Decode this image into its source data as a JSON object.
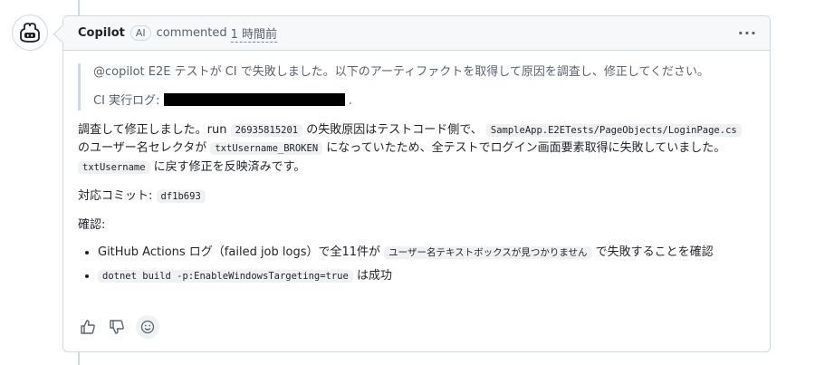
{
  "comment": {
    "author": "Copilot",
    "ai_badge": "AI",
    "action": "commented",
    "timestamp": "1 時間前",
    "quote_line1": "@copilot E2E テストが CI で失敗しました。以下のアーティファクトを取得して原因を調査し、修正してください。",
    "quote_line2_prefix": "CI 実行ログ:",
    "quote_line2_suffix": ".",
    "para1_a": "調査して修正しました。run ",
    "para1_code1": "26935815201",
    "para1_b": " の失敗原因はテストコード側で、",
    "para1_code2": "SampleApp.E2ETests/PageObjects/LoginPage.cs",
    "para1_c": " のユーザー名セレクタが ",
    "para1_code3": "txtUsername_BROKEN",
    "para1_d": " になっていたため、全テストでログイン画面要素取得に失敗していました。",
    "para1_code4": "txtUsername",
    "para1_e": " に戻す修正を反映済みです。",
    "commit_label": "対応コミット: ",
    "commit_hash": "df1b693",
    "confirm_label": "確認:",
    "bullet1_a": "GitHub Actions ログ（failed job logs）で全11件が ",
    "bullet1_code": "ユーザー名テキストボックスが見つかりません",
    "bullet1_b": " で失敗することを確認",
    "bullet2_code": "dotnet build -p:EnableWindowsTargeting=true",
    "bullet2_b": " は成功"
  },
  "icons": {
    "avatar": "copilot-icon",
    "menu": "kebab-icon",
    "thumbs_up": "thumbs-up-icon",
    "thumbs_down": "thumbs-down-icon",
    "emoji": "smiley-icon"
  }
}
